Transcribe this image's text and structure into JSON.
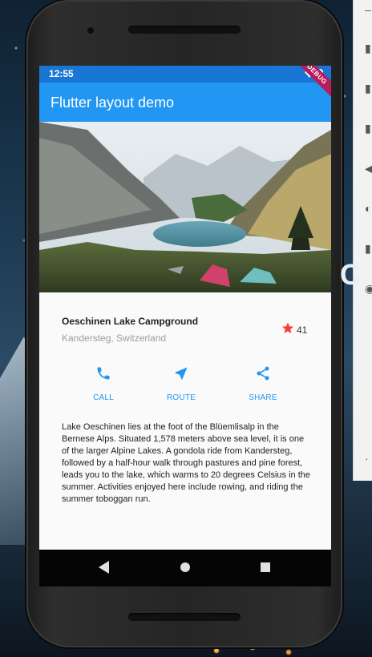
{
  "status_bar": {
    "time": "12:55"
  },
  "debug_banner": "DEBUG",
  "app_bar": {
    "title": "Flutter layout demo"
  },
  "place": {
    "title": "Oeschinen Lake Campground",
    "subtitle": "Kandersteg, Switzerland",
    "rating_count": "41"
  },
  "actions": [
    {
      "label": "CALL",
      "icon": "phone-icon"
    },
    {
      "label": "ROUTE",
      "icon": "navigation-icon"
    },
    {
      "label": "SHARE",
      "icon": "share-icon"
    }
  ],
  "description": "Lake Oeschinen lies at the foot of the Blüemlisalp in the Bernese Alps. Situated 1,578 meters above sea level, it is one of the larger Alpine Lakes. A gondola ride from Kandersteg, followed by a half-hour walk through pastures and pine forest, leads you to the lake, which warms to 20 degrees Celsius in the summer. Activities enjoyed here include rowing, and riding the summer toboggan run.",
  "colors": {
    "primary": "#2196f3",
    "primary_dark": "#1976d2",
    "star": "#f44336",
    "subtitle": "#9e9e9e"
  },
  "nav_bar": {
    "buttons": [
      "back-icon",
      "home-icon",
      "recents-icon"
    ]
  }
}
